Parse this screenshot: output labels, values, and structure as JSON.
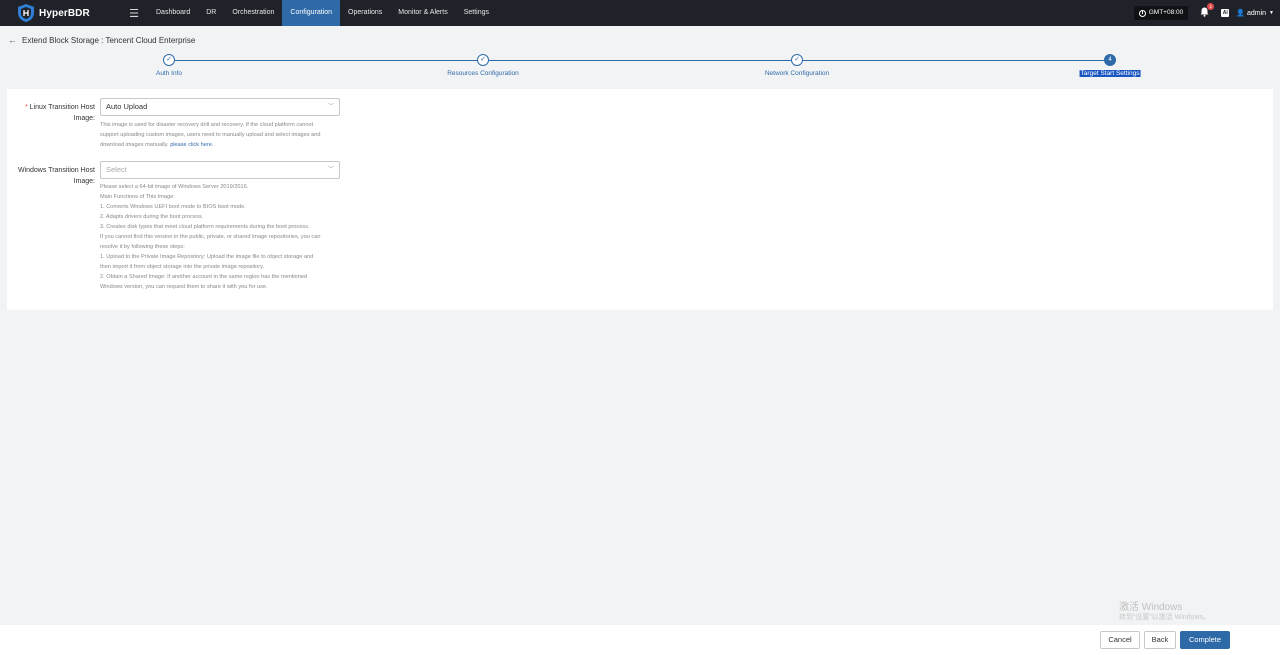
{
  "topbar": {
    "brand": "HyperBDR",
    "nav": [
      "Dashboard",
      "DR",
      "Orchestration",
      "Configuration",
      "Operations",
      "Monitor & Alerts",
      "Settings"
    ],
    "active_nav": "Configuration",
    "timezone": "GMT+08:00",
    "notification_count": "1",
    "ai_label": "AI",
    "user": "admin"
  },
  "page": {
    "title": "Extend Block Storage : Tencent Cloud Enterprise"
  },
  "steps": [
    {
      "label": "Auth Info",
      "state": "done"
    },
    {
      "label": "Resources Configuration",
      "state": "done"
    },
    {
      "label": "Network Configuration",
      "state": "done"
    },
    {
      "label": "Target Start Settings",
      "state": "current",
      "number": "4"
    }
  ],
  "form": {
    "linux": {
      "required_mark": "*",
      "label_line1": "Linux Transition Host",
      "label_line2": "Image:",
      "value": "Auto Upload",
      "hint_lines": [
        "This image is used for disaster recovery drill and recovery. If the cloud platform cannot",
        "support uploading custom images, users need to manually upload and select images and"
      ],
      "hint_last": "download images manually.",
      "hint_link": "please click here."
    },
    "windows": {
      "label_line1": "Windows Transition Host",
      "label_line2": "Image:",
      "placeholder": "Select",
      "hint_lines": [
        "Please select a 64-bit image of Windows Server 2019/2016.",
        "Main Functions of This Image:",
        "1. Converts Windows UEFI boot mode to BIOS boot mode.",
        "2. Adapts drivers during the boot process.",
        "3. Creates disk types that meet cloud platform requirements during the boot process.",
        "If you cannot find this version in the public, private, or shared image repositories, you can",
        "resolve it by following these steps:",
        "1. Upload to the Private Image Repository: Upload the image file to object storage and",
        "then import it from object storage into the private image repository.",
        "2. Obtain a Shared Image: If another account in the same region has the mentioned",
        "Windows version, you can request them to share it with you for use."
      ]
    }
  },
  "watermark": {
    "line1": "激活 Windows",
    "line2": "转到“设置”以激活 Windows。"
  },
  "footer": {
    "cancel": "Cancel",
    "back": "Back",
    "complete": "Complete"
  },
  "colors": {
    "topbar": "#1f2329",
    "accent": "#2f6aa8",
    "page_bg": "#f2f3f5"
  }
}
